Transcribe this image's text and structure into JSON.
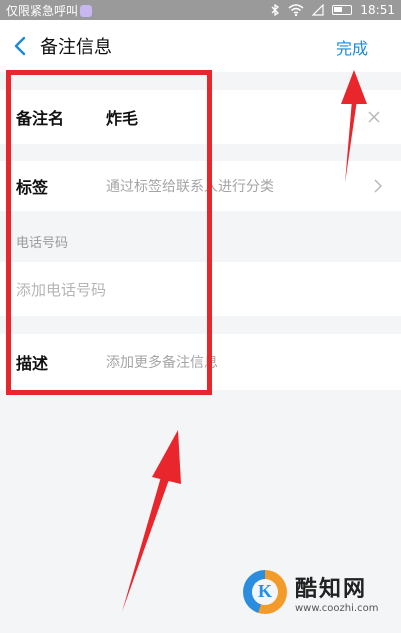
{
  "status_bar": {
    "carrier": "仅限紧急呼叫",
    "time": "18:51"
  },
  "header": {
    "title": "备注信息",
    "done_label": "完成"
  },
  "form": {
    "remark_name": {
      "label": "备注名",
      "value": "炸毛"
    },
    "tags": {
      "label": "标签",
      "placeholder": "通过标签给联系人进行分类"
    },
    "phone": {
      "caption": "电话号码",
      "placeholder": "添加电话号码"
    },
    "description": {
      "label": "描述",
      "placeholder": "添加更多备注信息"
    }
  },
  "colors": {
    "accent": "#1c8bd6",
    "annotation": "#e8262c"
  },
  "watermark": {
    "name": "酷知网",
    "url": "www.coozhi.com"
  }
}
